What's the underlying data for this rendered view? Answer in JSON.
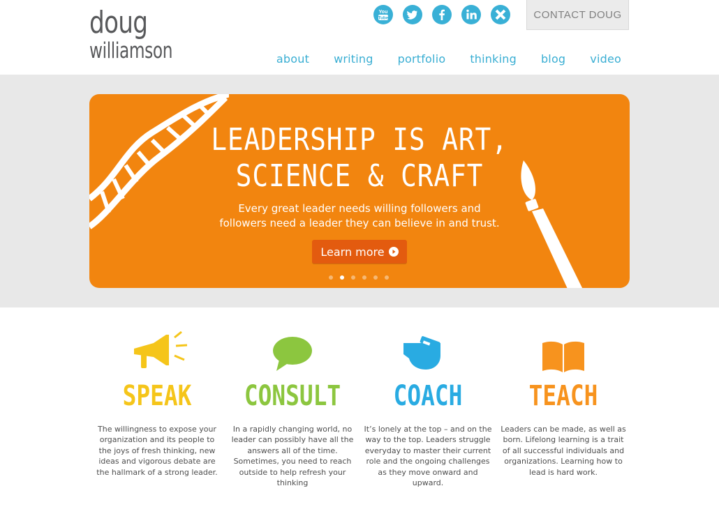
{
  "logo": {
    "line1": "doug",
    "line2": "williamson"
  },
  "social": [
    {
      "name": "youtube",
      "label": "You Tube"
    },
    {
      "name": "twitter",
      "label": ""
    },
    {
      "name": "facebook",
      "label": "f"
    },
    {
      "name": "linkedin",
      "label": "in"
    },
    {
      "name": "xing",
      "label": ""
    }
  ],
  "contact": {
    "label": "CONTACT DOUG"
  },
  "nav": [
    "about",
    "writing",
    "portfolio",
    "thinking",
    "blog",
    "video"
  ],
  "banner": {
    "headline1": "LEADERSHIP IS ART,",
    "headline2": "SCIENCE & CRAFT",
    "subtext1": "Every great leader needs willing followers and",
    "subtext2": "followers need a leader they can believe in and trust.",
    "cta": "Learn more",
    "slides": 6,
    "active_slide": 2
  },
  "features": [
    {
      "title": "SPEAK",
      "color": "#f5c51a",
      "icon": "megaphone-icon",
      "desc": "The willingness to expose your organization and its people to the joys of fresh thinking, new ideas and vigorous debate are the hallmark of a strong leader."
    },
    {
      "title": "CONSULT",
      "color": "#8cc63f",
      "icon": "speech-bubble-icon",
      "desc": "In a rapidly changing world, no leader can possibly have all the answers all of the time. Sometimes, you need to reach outside to help refresh your thinking"
    },
    {
      "title": "COACH",
      "color": "#29abe2",
      "icon": "whistle-icon",
      "desc": "It’s lonely at the top – and on the way to the top. Leaders struggle everyday to master their current role and the ongoing challenges as they move onward and upward."
    },
    {
      "title": "TEACH",
      "color": "#f7931e",
      "icon": "book-icon",
      "desc": "Leaders can be made, as well as born. Lifelong learning is a trait of all successful individuals and organizations. Learning how to lead is hard work."
    }
  ],
  "colors": {
    "accent": "#39aed3",
    "banner": "#f2850f",
    "button": "#e35b0f"
  }
}
